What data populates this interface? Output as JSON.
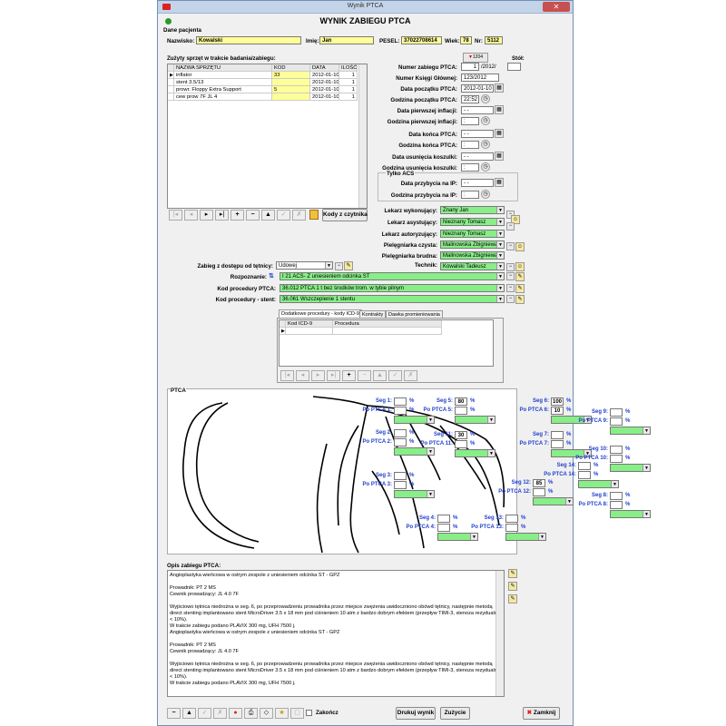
{
  "window": {
    "title": "Wynik PTCA",
    "close": "✕"
  },
  "header": {
    "title": "WYNIK ZABIEGU PTCA"
  },
  "patient": {
    "section": "Dane pacjenta",
    "surname_label": "Nazwisko:",
    "surname": "Kowalski",
    "name_label": "Imię:",
    "name": "Jan",
    "pesel_label": "PESEL:",
    "pesel": "37022708614",
    "age_label": "Wiek:",
    "age": "78",
    "nr_label": "Nr:",
    "nr": "5112"
  },
  "equipment": {
    "section": "Zużyty sprzęt w trakcie badania/zabiegu:",
    "columns": [
      "NAZWA SPRZĘTU",
      "KOD",
      "DATA",
      "ILOŚĆ"
    ],
    "rows": [
      [
        "inflator",
        "33",
        "2012-01-10",
        "1"
      ],
      [
        "stent 3.5/13",
        "",
        "2012-01-10",
        "1"
      ],
      [
        "prowr. Floppy Extra Support",
        "5",
        "2012-01-10",
        "1"
      ],
      [
        "cew prow 7F JL 4",
        "",
        "2012-01-10",
        "1"
      ]
    ],
    "kody_button": "Kody z czytnika"
  },
  "procedure": {
    "badge": "1204",
    "stol_label": "Stół:",
    "numer_label": "Numer zabiegu PTCA:",
    "numer": "1",
    "numer_suffix": "/2012/",
    "ksiega_label": "Numer Księgi Głównej:",
    "ksiega": "123/2012",
    "data_pocz_label": "Data początku PTCA:",
    "data_pocz": "2012-01-10",
    "godz_pocz_label": "Godzina początku PTCA:",
    "godz_pocz": "22:52",
    "data_infl_label": "Data pierwszej inflacji:",
    "data_infl": "- -",
    "godz_infl_label": "Godzina pierwszej inflacji:",
    "godz_infl": ":",
    "data_konca_label": "Data końca PTCA:",
    "data_konca": "- -",
    "godz_konca_label": "Godzina końca PTCA:",
    "godz_konca": ":",
    "data_usun_label": "Data usunięcia koszulki:",
    "data_usun": "- -",
    "godz_usun_label": "Godzina usunięcia koszulki:",
    "godz_usun": ":",
    "acs_label": "Tylko ACS",
    "data_przyb_label": "Data przybycia na IP:",
    "data_przyb": "- -",
    "godz_przyb_label": "Godzina przybycia na IP:",
    "godz_przyb": ":"
  },
  "staff": {
    "wyk_label": "Lekarz wykonujący:",
    "wyk": "Znany Jan",
    "asyst_label": "Lekarz asystujący:",
    "asyst": "Nieznany Tomasz",
    "autor_label": "Lekarz autoryzujący:",
    "autor": "Nieznany Tomasz",
    "piel_czysta_label": "Pielęgniarka czysta:",
    "piel_czysta": "Malinowska Zbigniewa",
    "piel_brudna_label": "Pielęgniarka brudna:",
    "piel_brudna": "Malinowska Zbigniewa",
    "technik_label": "Technik:",
    "technik": "Kowalski Tadeusz"
  },
  "access": {
    "dostep_label": "Zabieg z dostępu od tętnicy:",
    "dostep": "Udowej",
    "rozp_label": "Rozpoznanie:",
    "rozp": "I 21  ACS- Z uniesieniem odcinka ST",
    "kod_label": "Kod procedury PTCA:",
    "kod": "36.012  PTCA 1 t bez środków trom. w tybie pilnym",
    "stent_label": "Kod procedury - stent:",
    "stent": "36.061  Wszczepienie 1 stentu"
  },
  "tabs": {
    "items": [
      "Dodatkowe procedury - kody ICD-9",
      "Kontrakty",
      "Dawka promieniowania"
    ],
    "columns": [
      "Kod ICD-9",
      "Procedura"
    ]
  },
  "ptca": {
    "title": "PTCA",
    "pct": "%",
    "segments": [
      {
        "seg": "Seg 1:",
        "po": "Po PTCA 1:",
        "val": ""
      },
      {
        "seg": "Seg 2:",
        "po": "Po PTCA 2:",
        "val": ""
      },
      {
        "seg": "Seg 3:",
        "po": "Po PTCA 3:",
        "val": ""
      },
      {
        "seg": "Seg 4:",
        "po": "Po PTCA 4:",
        "val": ""
      },
      {
        "seg": "Seg 5:",
        "po": "Po PTCA 5:",
        "val": "80"
      },
      {
        "seg": "Seg 6:",
        "po": "Po PTCA 6:",
        "val": "100",
        "po_val": "10"
      },
      {
        "seg": "Seg 7:",
        "po": "Po PTCA 7:",
        "val": ""
      },
      {
        "seg": "Seg 8:",
        "po": "Po PTCA 8:",
        "val": ""
      },
      {
        "seg": "Seg 9:",
        "po": "Po PTCA 9:",
        "val": ""
      },
      {
        "seg": "Seg 10:",
        "po": "Po PTCA 10:",
        "val": ""
      },
      {
        "seg": "Seg 11:",
        "po": "Po PTCA 11:",
        "val": "30"
      },
      {
        "seg": "Seg 12:",
        "po": "Po PTCA 12:",
        "val": "85"
      },
      {
        "seg": "Seg 13:",
        "po": "Po PTCA 13:",
        "val": ""
      },
      {
        "seg": "Seg 14:",
        "po": "Po PTCA 14:",
        "val": ""
      }
    ]
  },
  "opis": {
    "label": "Opis zabiegu PTCA:",
    "text": "Angioplastyka wieńcowa w ostrym zespole z uniesieniem odcinka ST - GPZ\n\nProwadnik: PT 2 MS\nCewnik prowadzący: JL 4.0 7F\n\nWyjściowo tętnica niedrożna w seg. 6, po przeprowadzeniu prowadnika przez miejsce zwężenia uwidoczniono obówd tętnicy, następnie metodą direct stenting implantowano stent MicroDriver 3.5 x 18 mm pod ciśnieniem 10 atm z bardzo dobrym efektem (przepływ TIMI-3, stenoza rezydualna < 10%).\nW trakcie zabiegu podano PLAVIX 300 mg, UFH 7500 j.\nAngioplastyka wieńcowa w ostrym zespole z uniesieniem odcinka ST - GPZ\n\nProwadnik: PT 2 MS\nCewnik prowadzący: JL 4.0 7F\n\nWyjściowo tętnica niedrożna w seg. 6, po przeprowadzeniu prowadnika przez miejsce zwężenia uwidoczniono obówd tętnicy, następnie metodą direct stenting implantowano stent MicroDriver 3.5 x 18 mm pod ciśnieniem 10 atm z bardzo dobrym efektem (przepływ TIMI-3, stenoza rezydualna < 10%).\nW trakcie zabiegu podano PLAVIX 300 mg, UFH 7500 j."
  },
  "footer": {
    "zakoncz": "Zakończ",
    "drukuj": "Drukuj wynik",
    "zuzycie": "Zużycie",
    "zamknij": "Zamknij"
  }
}
